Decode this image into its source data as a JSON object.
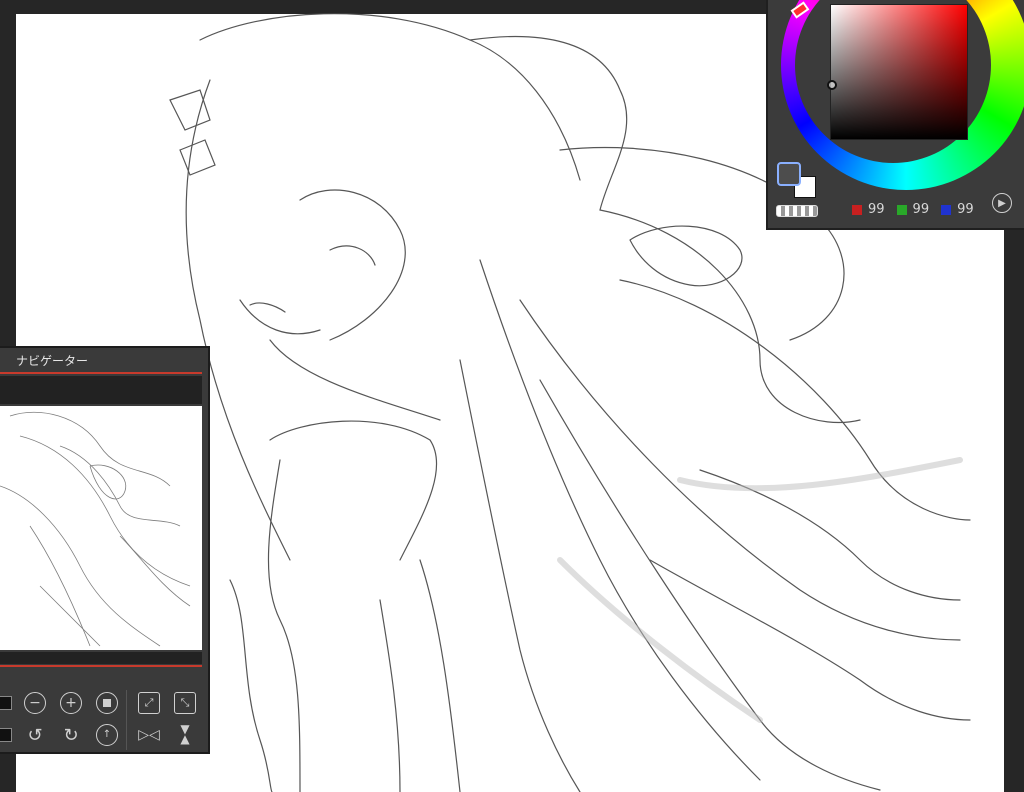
{
  "navigator": {
    "title": "ナビゲーター"
  },
  "color_panel": {
    "main_color": "#4d4d4d",
    "sub_color": "#ffffff",
    "hue_marker_color": "#ff3030",
    "rgb": [
      {
        "channel": "red",
        "chip": "#c82020",
        "value": "99"
      },
      {
        "channel": "green",
        "chip": "#29a829",
        "value": "99"
      },
      {
        "channel": "blue",
        "chip": "#2033d0",
        "value": "99"
      }
    ]
  },
  "icons": {
    "zoom_out": "minus-circle-icon",
    "zoom_in": "plus-circle-icon",
    "fit": "stop-square-icon",
    "actual_size": "expand-arrows-icon",
    "fit_window": "diagonal-arrows-icon",
    "rotate_left": "rotate-left-icon",
    "rotate_right": "rotate-right-icon",
    "reset_rotation": "reset-rotation-icon",
    "flip_horizontal": "flip-horizontal-icon",
    "flip_vertical": "flip-vertical-icon",
    "play": "play-icon"
  }
}
